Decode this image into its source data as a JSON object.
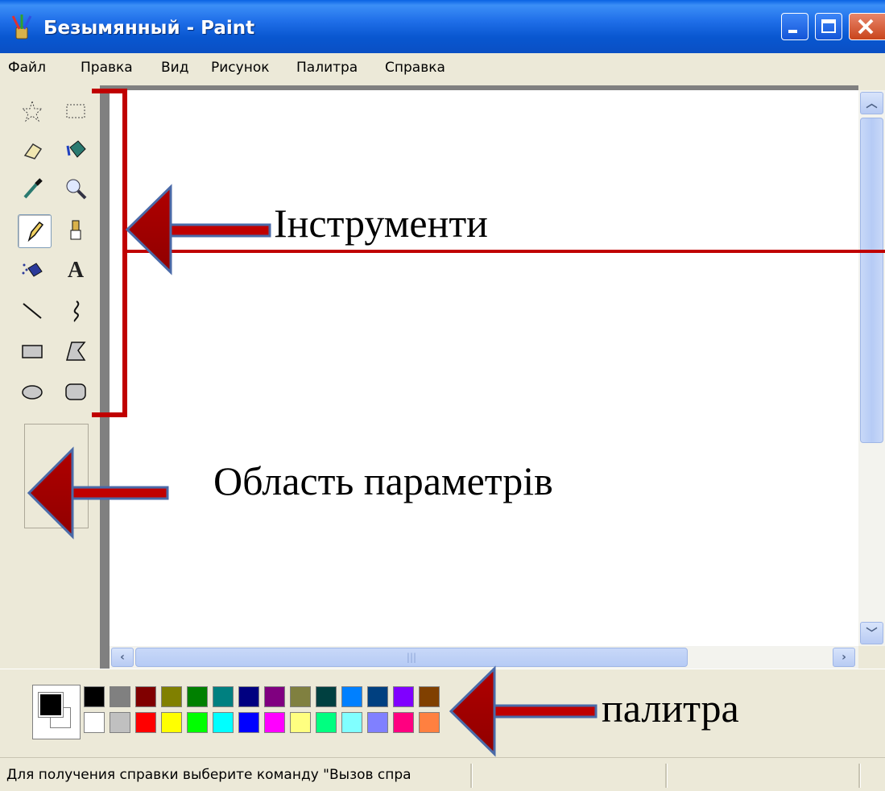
{
  "window": {
    "title": "Безымянный - Paint",
    "controls": [
      "minimize",
      "maximize",
      "close"
    ]
  },
  "menu": {
    "items": [
      "Файл",
      "Правка",
      "Вид",
      "Рисунок",
      "Палитра",
      "Справка"
    ]
  },
  "toolbox": {
    "tools": [
      {
        "name": "free-form-select",
        "icon": "star-select-icon"
      },
      {
        "name": "rect-select",
        "icon": "rect-select-icon"
      },
      {
        "name": "eraser",
        "icon": "eraser-icon"
      },
      {
        "name": "fill",
        "icon": "paint-bucket-icon"
      },
      {
        "name": "pick-color",
        "icon": "eyedropper-icon"
      },
      {
        "name": "magnifier",
        "icon": "magnifier-icon"
      },
      {
        "name": "pencil",
        "icon": "pencil-icon",
        "selected": true
      },
      {
        "name": "brush",
        "icon": "brush-icon"
      },
      {
        "name": "airbrush",
        "icon": "airbrush-icon"
      },
      {
        "name": "text",
        "icon": "text-icon",
        "glyph": "A"
      },
      {
        "name": "line",
        "icon": "line-icon"
      },
      {
        "name": "curve",
        "icon": "curve-icon"
      },
      {
        "name": "rectangle",
        "icon": "rectangle-icon"
      },
      {
        "name": "polygon",
        "icon": "polygon-icon"
      },
      {
        "name": "ellipse",
        "icon": "ellipse-icon"
      },
      {
        "name": "rounded-rectangle",
        "icon": "rounded-rect-icon"
      }
    ]
  },
  "palette": {
    "foreground": "#000000",
    "background": "#ffffff",
    "top_row": [
      "#000000",
      "#808080",
      "#800000",
      "#808000",
      "#008000",
      "#008080",
      "#000080",
      "#800080",
      "#808040",
      "#004040",
      "#0080ff",
      "#004080",
      "#8000ff",
      "#804000"
    ],
    "bottom_row": [
      "#ffffff",
      "#c0c0c0",
      "#ff0000",
      "#ffff00",
      "#00ff00",
      "#00ffff",
      "#0000ff",
      "#ff00ff",
      "#ffff80",
      "#00ff80",
      "#80ffff",
      "#8080ff",
      "#ff0080",
      "#ff8040"
    ]
  },
  "status": {
    "text": "Для получения справки выберите команду \"Вызов спра"
  },
  "annotations": {
    "tools": "Інструменти",
    "params": "Область параметрів",
    "palette": "палитра"
  },
  "colors": {
    "title_bar": "#0a57d0",
    "annotation_red": "#c00000",
    "annotation_arrow": "#c00000"
  }
}
